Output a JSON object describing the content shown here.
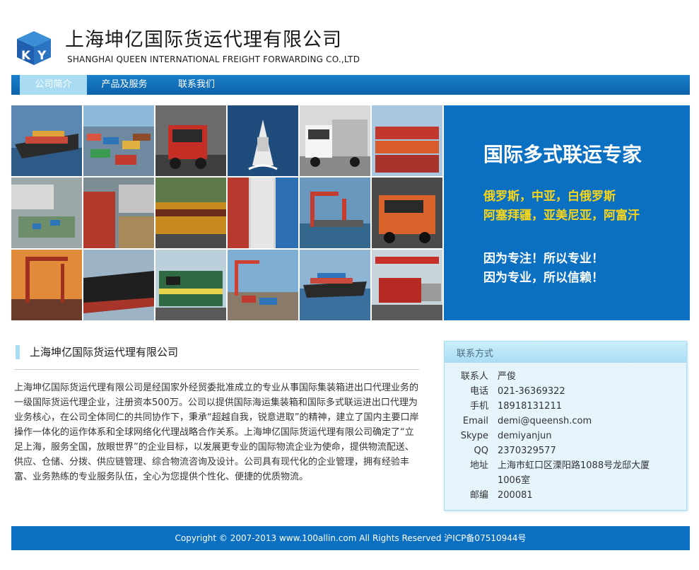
{
  "header": {
    "logo_letters": [
      "K",
      "Y"
    ],
    "company_name_cn": "上海坤亿国际货运代理有限公司",
    "company_name_en": "SHANGHAI QUEEN INTERNATIONAL FREIGHT FORWARDING CO.,LTD"
  },
  "nav": {
    "items": [
      {
        "label": "公司简介",
        "active": true
      },
      {
        "label": "产品及服务",
        "active": false
      },
      {
        "label": "联系我们",
        "active": false
      }
    ]
  },
  "banner": {
    "photo_subjects": [
      "container-ship",
      "container-yard",
      "red-truck",
      "ship-at-sea",
      "white-truck",
      "container-stack",
      "warehouse-aerial",
      "containers-closeup",
      "yellow-locomotive",
      "stacked-containers",
      "port-cranes",
      "orange-truck",
      "crane-sunset",
      "ship-hull",
      "green-locomotive",
      "port-terminal",
      "cargo-ship",
      "red-locomotive"
    ],
    "promo_title": "国际多式联运专家",
    "regions_line1": "俄罗斯，中亚，白俄罗斯",
    "regions_line2": "阿塞拜疆，亚美尼亚，阿富汗",
    "slogan_line1": "因为专注！所以专业！",
    "slogan_line2": "因为专业，所以信赖！"
  },
  "about": {
    "title": "上海坤亿国际货运代理有限公司",
    "body": "上海坤亿国际货运代理有限公司是经国家外经贸委批准成立的专业从事国际集装箱进出口代理业务的一级国际货运代理企业，注册资本500万。公司以提供国际海运集装箱和国际多式联运进出口代理为业务核心，在公司全体同仁的共同协作下，秉承“超越自我，锐意进取”的精神，建立了国内主要口岸操作一体化的运作体系和全球网络化代理战略合作关系。上海坤亿国际货运代理有限公司确定了“立足上海，服务全国，放眼世界”的企业目标，以发展更专业的国际物流企业为使命，提供物流配送、供应、仓储、分拨、供应链管理、综合物流咨询及设计。公司具有现代化的企业管理，拥有经验丰富、业务熟练的专业服务队伍，全心为您提供个性化、便捷的优质物流。"
  },
  "contact": {
    "header": "联系方式",
    "rows": [
      {
        "label": "联系人",
        "value": "严俊"
      },
      {
        "label": "电话",
        "value": "021-36369322"
      },
      {
        "label": "手机",
        "value": "18918131211"
      },
      {
        "label": "Email",
        "value": "demi@queensh.com"
      },
      {
        "label": "Skype",
        "value": "demiyanjun"
      },
      {
        "label": "QQ",
        "value": "2370329577"
      },
      {
        "label": "地址",
        "value": "上海市虹口区溧阳路1088号龙邸大厦1006室"
      },
      {
        "label": "邮编",
        "value": "200081"
      }
    ]
  },
  "footer": {
    "copyright": "Copyright © 2007-2013 www.100allin.com All Rights Reserved 沪ICP备07510944号"
  },
  "colors": {
    "brand_blue": "#0b6fc2",
    "nav_active": "#a9dcf3",
    "promo_yellow": "#f7d51c",
    "contact_bg": "#e6f5fb"
  }
}
